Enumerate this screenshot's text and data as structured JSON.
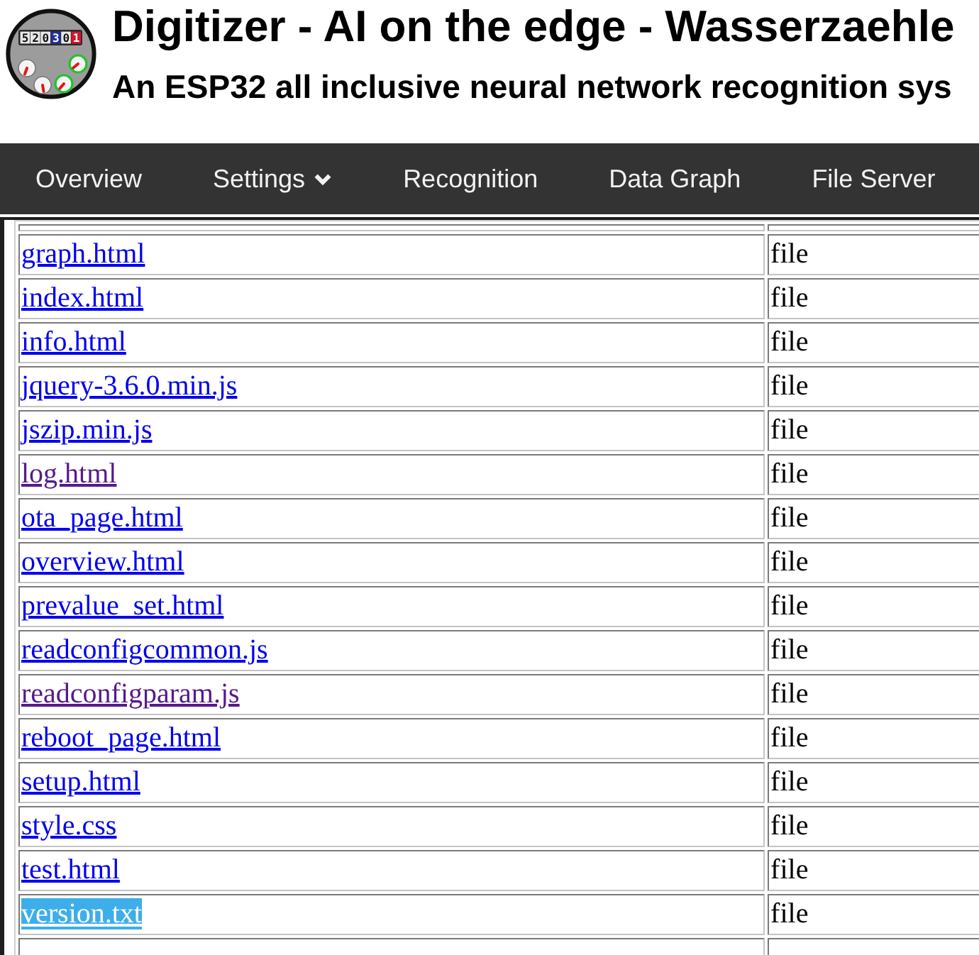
{
  "header": {
    "logo": {
      "digits": "520301"
    },
    "title": "Digitizer - AI on the edge - Wasserzaehle",
    "subtitle": "An ESP32 all inclusive neural network recognition sys"
  },
  "nav": [
    {
      "label": "Overview",
      "has_dropdown": false
    },
    {
      "label": "Settings",
      "has_dropdown": true
    },
    {
      "label": "Recognition",
      "has_dropdown": false
    },
    {
      "label": "Data Graph",
      "has_dropdown": false
    },
    {
      "label": "File Server",
      "has_dropdown": false
    }
  ],
  "file_table": {
    "rows": [
      {
        "name": "graph.html",
        "type": "file",
        "visited": false,
        "highlighted": false
      },
      {
        "name": "index.html",
        "type": "file",
        "visited": false,
        "highlighted": false
      },
      {
        "name": "info.html",
        "type": "file",
        "visited": false,
        "highlighted": false
      },
      {
        "name": "jquery-3.6.0.min.js",
        "type": "file",
        "visited": false,
        "highlighted": false
      },
      {
        "name": "jszip.min.js",
        "type": "file",
        "visited": false,
        "highlighted": false
      },
      {
        "name": "log.html",
        "type": "file",
        "visited": true,
        "highlighted": false
      },
      {
        "name": "ota_page.html",
        "type": "file",
        "visited": false,
        "highlighted": false
      },
      {
        "name": "overview.html",
        "type": "file",
        "visited": false,
        "highlighted": false
      },
      {
        "name": "prevalue_set.html",
        "type": "file",
        "visited": false,
        "highlighted": false
      },
      {
        "name": "readconfigcommon.js",
        "type": "file",
        "visited": false,
        "highlighted": false
      },
      {
        "name": "readconfigparam.js",
        "type": "file",
        "visited": true,
        "highlighted": false
      },
      {
        "name": "reboot_page.html",
        "type": "file",
        "visited": false,
        "highlighted": false
      },
      {
        "name": "setup.html",
        "type": "file",
        "visited": false,
        "highlighted": false
      },
      {
        "name": "style.css",
        "type": "file",
        "visited": false,
        "highlighted": false
      },
      {
        "name": "test.html",
        "type": "file",
        "visited": false,
        "highlighted": false
      },
      {
        "name": "version.txt",
        "type": "file",
        "visited": false,
        "highlighted": true
      }
    ]
  }
}
